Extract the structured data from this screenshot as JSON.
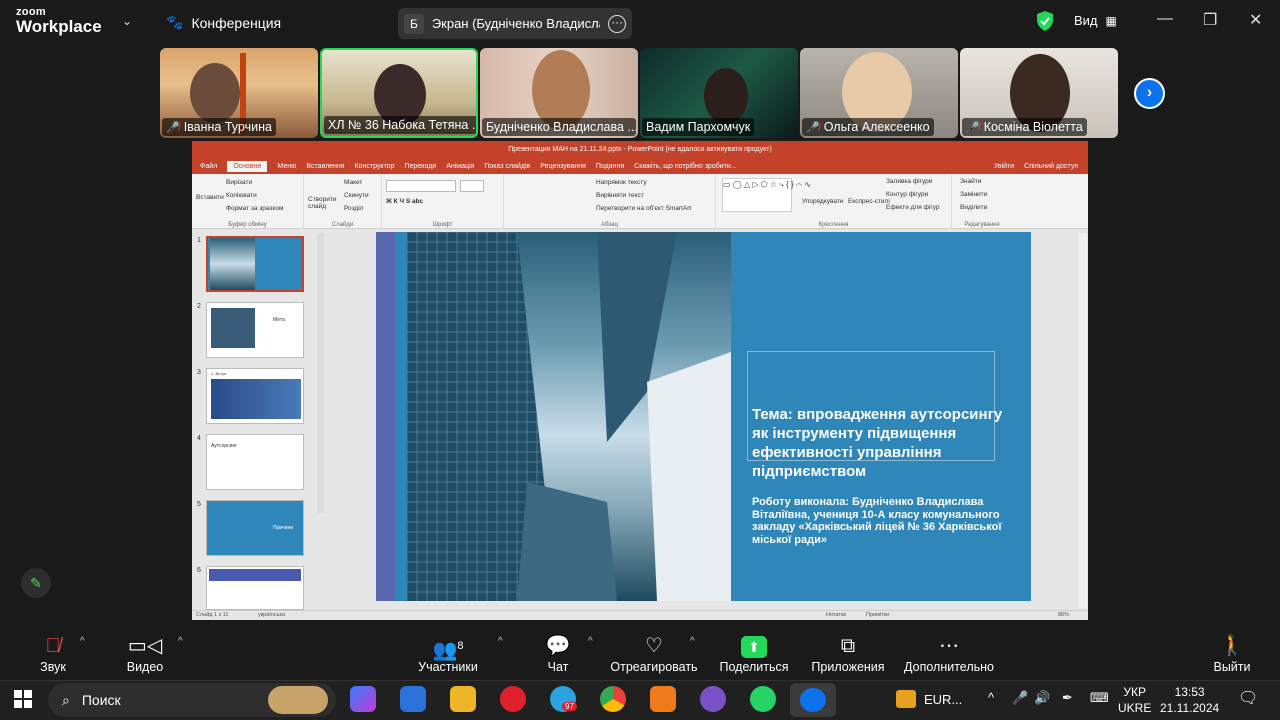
{
  "zoom": {
    "brand_top": "zoom",
    "brand_bottom": "Workplace",
    "meeting_title": "Конференция",
    "share_badge": "Б",
    "share_title": "Экран (Будніченко Владислава Віталіївна)",
    "view_label": "Вид"
  },
  "participants": [
    {
      "name": "Іванна Турчина",
      "muted": true
    },
    {
      "name": "ХЛ № 36  Набока Тетяна ...",
      "muted": false,
      "active": true
    },
    {
      "name": "Будніченко Владислава ...",
      "muted": false
    },
    {
      "name": "Вадим Пархомчук",
      "muted": false
    },
    {
      "name": "Ольга Алексеенко",
      "muted": true
    },
    {
      "name": "Косміна Віолетта",
      "muted": true
    }
  ],
  "ppt": {
    "title": "Презентация МАН на 21.11.24.pptx - PowerPoint (не вдалося активувати продукт)",
    "tabs": [
      "Файл",
      "Основне",
      "Меню",
      "Вставлення",
      "Конструктор",
      "Переходи",
      "Анімація",
      "Показ слайдів",
      "Рецензування",
      "Подання",
      "Скажіть, що потрібно зробити..."
    ],
    "sign_in": "Увійти",
    "share": "Спільний доступ",
    "ribbon": {
      "paste": "Вставити",
      "cut": "Вирізати",
      "copy": "Копіювати",
      "format_painter": "Формат за зразком",
      "clipboard": "Буфер обміну",
      "new_slide": "Створити слайд",
      "layout": "Макет",
      "reset": "Скинути",
      "section": "Розділ",
      "slides": "Слайди",
      "font": "Шрифт",
      "text_direction": "Напрямок тексту",
      "align_text": "Вирівняти текст",
      "convert_smartart": "Перетворити на об'єкт SmartArt",
      "paragraph": "Абзац",
      "arrange": "Упорядкувати",
      "quick_styles": "Експрес-стилі",
      "shape_fill": "Заливка фігури",
      "shape_outline": "Контур фігури",
      "shape_effects": "Ефекти для фігур",
      "drawing": "Креслення",
      "find": "Знайти",
      "replace": "Замінити",
      "select": "Виділити",
      "editing": "Редагування"
    },
    "thumb_labels": {
      "t2": "Мета",
      "t3": "1. Вступ",
      "t4": "Аутсорсинг",
      "t5": "Причини"
    },
    "slide_title": "Тема: впровадження аутсорсингу як інструменту підвищення ефективності управління підприємством",
    "slide_sub": "Роботу виконала: Будніченко Владислава Віталіївна, учениця 10-А класу комунального закладу «Харківський  ліцей № 36 Харківської міської ради»",
    "status_left": "Слайд 1 з 11",
    "status_lang": "українська",
    "status_notes": "Нотатки",
    "status_comments": "Примітки",
    "zoom_pct": "88%"
  },
  "toolbar": {
    "audio": "Звук",
    "video": "Видео",
    "participants": "Участники",
    "participants_count": "8",
    "chat": "Чат",
    "react": "Отреагировать",
    "share": "Поделиться",
    "apps": "Приложения",
    "more": "Дополнительно",
    "leave": "Выйти"
  },
  "taskbar": {
    "search": "Поиск",
    "eur": "EUR...",
    "lang1": "УКР",
    "lang2": "UKRE",
    "time": "13:53",
    "date": "21.11.2024",
    "telegram_badge": "97"
  },
  "colors": {
    "ppt_red": "#c4412a",
    "slide_blue": "#2e86b9",
    "zoom_blue": "#0e72ed",
    "active_green": "#23d959"
  }
}
